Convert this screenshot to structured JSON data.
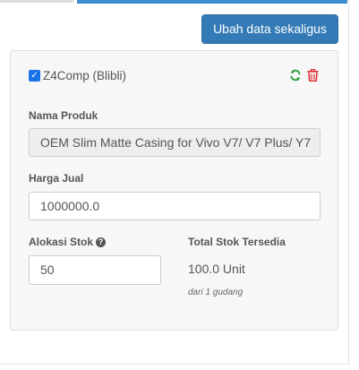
{
  "header": {
    "bulk_update_label": "Ubah data sekaligus"
  },
  "store": {
    "checked": true,
    "name": "Z4Comp (Blibli)"
  },
  "product": {
    "name_label": "Nama Produk",
    "name_value": "OEM Slim Matte Casing for Vivo V7/ V7 Plus/ Y7",
    "price_label": "Harga Jual",
    "price_value": "1000000.0",
    "alloc_label": "Alokasi Stok",
    "alloc_value": "50",
    "total_label": "Total Stok Tersedia",
    "total_value": "100.0 Unit",
    "total_sub": "dari 1 gudang"
  },
  "colors": {
    "primary": "#337ab7",
    "sync_icon": "#2e9e3f",
    "trash_icon": "#d9262a",
    "checkbox": "#1a73e8"
  },
  "icons": [
    "check-icon",
    "sync-icon",
    "trash-icon",
    "question-circle-icon"
  ]
}
